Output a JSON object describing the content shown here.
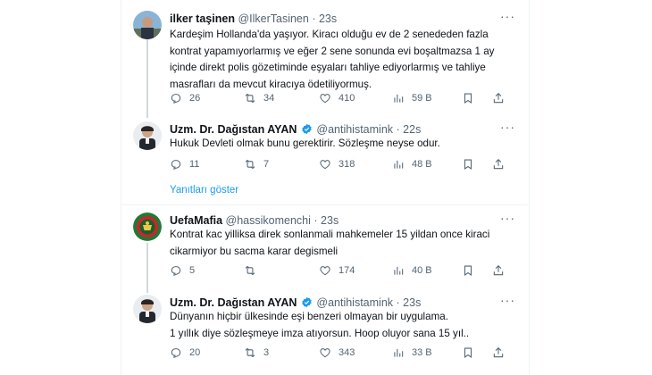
{
  "tweets": [
    {
      "name": "ilker taşinen",
      "handle": "@IlkerTasinen",
      "time": "23s",
      "verified": false,
      "text": "Kardeşim Hollanda'da yaşıyor. Kiracı olduğu ev de 2 senededen fazla kontrat yapamıyorlarmış ve eğer 2 sene sonunda evi boşaltmazsa 1 ay içinde direkt polis gözetiminde eşyaları tahliye ediyorlarmış ve tahliye masrafları da mevcut kiracıya ödetiliyormuş.",
      "replies": "26",
      "retweets": "34",
      "likes": "410",
      "views": "59 B"
    },
    {
      "name": "Uzm. Dr. Dağıstan AYAN",
      "handle": "@antihistamink",
      "time": "22s",
      "verified": true,
      "text": "Hukuk Devleti olmak bunu gerektirir. Sözleşme neyse odur.",
      "replies": "11",
      "retweets": "7",
      "likes": "318",
      "views": "48 B"
    },
    {
      "name": "UefaMafia",
      "handle": "@hassikomenchi",
      "time": "23s",
      "verified": false,
      "text": "Kontrat kac yilliksa direk sonlanmali mahkemeler 15 yildan once kiraci cikarmiyor bu sacma karar degismeli",
      "replies": "5",
      "retweets": "",
      "likes": "174",
      "views": "40 B"
    },
    {
      "name": "Uzm. Dr. Dağıstan AYAN",
      "handle": "@antihistamink",
      "time": "23s",
      "verified": true,
      "text": "Dünyanın hiçbir ülkesinde eşi benzeri olmayan bir uygulama.\n1 yıllık diye sözleşmeye imza atıyorsun. Hoop oluyor sana 15 yıl..",
      "replies": "20",
      "retweets": "3",
      "likes": "343",
      "views": "33 B"
    }
  ],
  "show_replies_label": "Yanıtları göster",
  "colors": {
    "accent": "#1d9bf0",
    "muted": "#536471",
    "text": "#0f1419",
    "verified": "#1d9bf0"
  }
}
